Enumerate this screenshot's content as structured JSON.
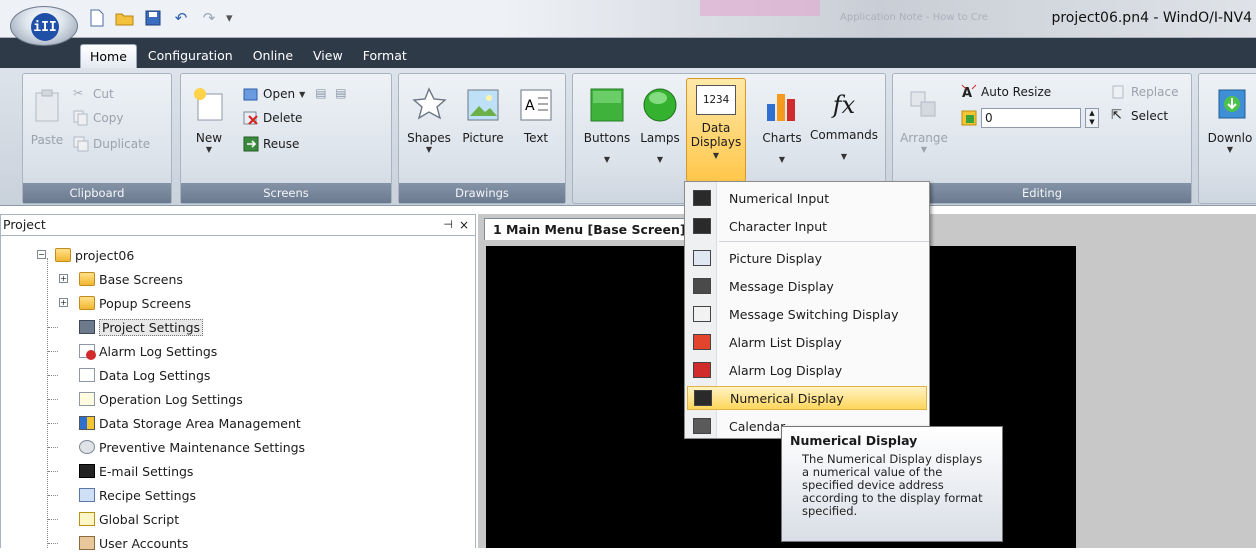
{
  "window": {
    "title": "project06.pn4 - WindO/I-NV4",
    "ghost_text": "Application Note - How to Cre"
  },
  "app_button": {
    "glyph": "iII"
  },
  "menu_tabs": [
    {
      "label": "Home",
      "active": true
    },
    {
      "label": "Configuration",
      "active": false
    },
    {
      "label": "Online",
      "active": false
    },
    {
      "label": "View",
      "active": false
    },
    {
      "label": "Format",
      "active": false
    }
  ],
  "ribbon": {
    "clipboard": {
      "group_label": "Clipboard",
      "paste": "Paste",
      "cut": "Cut",
      "copy": "Copy",
      "duplicate": "Duplicate"
    },
    "screens": {
      "group_label": "Screens",
      "new": "New",
      "open": "Open",
      "delete": "Delete",
      "reuse": "Reuse"
    },
    "drawings": {
      "group_label": "Drawings",
      "shapes": "Shapes",
      "picture": "Picture",
      "text": "Text"
    },
    "parts": {
      "buttons": "Buttons",
      "lamps": "Lamps",
      "data_displays_line1": "Data",
      "data_displays_line2": "Displays",
      "data_displays_icon_text": "1234",
      "charts": "Charts",
      "commands": "Commands",
      "commands_icon_text": "fx"
    },
    "editing": {
      "group_label": "Editing",
      "arrange": "Arrange",
      "auto_resize": "Auto Resize",
      "spin_value": "0",
      "replace": "Replace",
      "select": "Select"
    },
    "download": {
      "label": "Downlo"
    }
  },
  "project_panel": {
    "title": "Project",
    "pin_icon": "⊣",
    "close_icon": "×",
    "tree": [
      {
        "label": "project06",
        "level": 0,
        "expander": "−",
        "icon": "folder"
      },
      {
        "label": "Base Screens",
        "level": 1,
        "expander": "+",
        "icon": "folder"
      },
      {
        "label": "Popup Screens",
        "level": 1,
        "expander": "+",
        "icon": "folder"
      },
      {
        "label": "Project Settings",
        "level": 1,
        "icon": "settings",
        "selected": true
      },
      {
        "label": "Alarm Log Settings",
        "level": 1,
        "icon": "alarm"
      },
      {
        "label": "Data Log Settings",
        "level": 1,
        "icon": "datalog"
      },
      {
        "label": "Operation Log Settings",
        "level": 1,
        "icon": "oplog"
      },
      {
        "label": "Data Storage Area Management",
        "level": 1,
        "icon": "storage"
      },
      {
        "label": "Preventive Maintenance Settings",
        "level": 1,
        "icon": "maint"
      },
      {
        "label": "E-mail Settings",
        "level": 1,
        "icon": "email"
      },
      {
        "label": "Recipe Settings",
        "level": 1,
        "icon": "recipe"
      },
      {
        "label": "Global Script",
        "level": 1,
        "icon": "script"
      },
      {
        "label": "User Accounts",
        "level": 1,
        "icon": "users"
      }
    ]
  },
  "document_tab": {
    "label": "1 Main Menu [Base Screen]"
  },
  "data_displays_menu": [
    {
      "label": "Numerical Input"
    },
    {
      "label": "Character Input"
    },
    {
      "label": "Picture Display"
    },
    {
      "label": "Message Display"
    },
    {
      "label": "Message Switching Display"
    },
    {
      "label": "Alarm List Display"
    },
    {
      "label": "Alarm Log Display"
    },
    {
      "label": "Numerical Display",
      "highlighted": true
    },
    {
      "label": "Calendar"
    }
  ],
  "tooltip": {
    "title": "Numerical Display",
    "body": "The Numerical Display displays a numerical value of the specified device address according to the display format specified."
  },
  "colors": {
    "tab_bar": "#2f3a49",
    "ribbon_group_label": "#6b7a90",
    "highlight": "#ffd65c",
    "canvas": "#000000",
    "workspace": "#c8c8c8"
  }
}
